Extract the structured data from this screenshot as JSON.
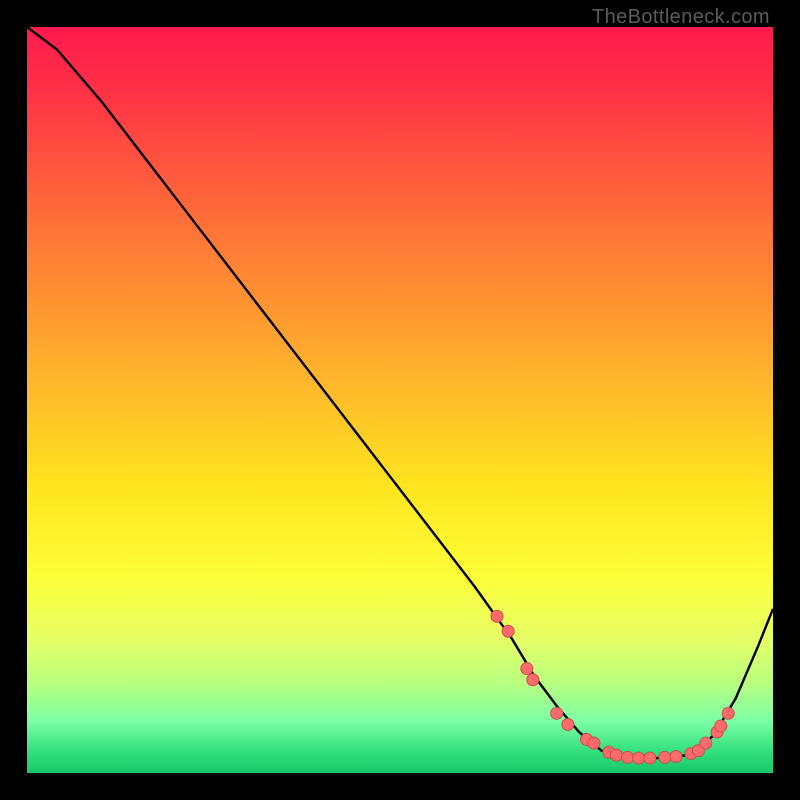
{
  "watermark": "TheBottleneck.com",
  "colors": {
    "bg": "#000000",
    "curve": "#000000",
    "marker_fill": "#ff6b6b",
    "marker_stroke": "#c94b4b"
  },
  "chart_data": {
    "type": "line",
    "title": "",
    "xlabel": "",
    "ylabel": "",
    "xlim": [
      0,
      100
    ],
    "ylim": [
      0,
      100
    ],
    "series": [
      {
        "name": "curve",
        "x": [
          0,
          4,
          10,
          20,
          30,
          40,
          50,
          60,
          65,
          68,
          71,
          74,
          77,
          80,
          83,
          86,
          89,
          92,
          95,
          98,
          100
        ],
        "y": [
          100,
          97,
          90,
          77,
          64,
          51,
          38,
          25,
          18,
          13,
          9,
          5.5,
          3,
          2,
          2,
          2,
          2.5,
          5,
          10,
          17,
          22
        ]
      }
    ],
    "markers": [
      {
        "x": 63,
        "y": 21
      },
      {
        "x": 64.5,
        "y": 19
      },
      {
        "x": 67,
        "y": 14
      },
      {
        "x": 67.8,
        "y": 12.5
      },
      {
        "x": 71,
        "y": 8
      },
      {
        "x": 72.5,
        "y": 6.5
      },
      {
        "x": 75,
        "y": 4.5
      },
      {
        "x": 76,
        "y": 4
      },
      {
        "x": 78,
        "y": 2.8
      },
      {
        "x": 79,
        "y": 2.4
      },
      {
        "x": 80.5,
        "y": 2.1
      },
      {
        "x": 82,
        "y": 2
      },
      {
        "x": 83.5,
        "y": 2
      },
      {
        "x": 85.5,
        "y": 2.1
      },
      {
        "x": 87,
        "y": 2.2
      },
      {
        "x": 89,
        "y": 2.6
      },
      {
        "x": 90,
        "y": 3
      },
      {
        "x": 91,
        "y": 4
      },
      {
        "x": 92.5,
        "y": 5.5
      },
      {
        "x": 93,
        "y": 6.3
      },
      {
        "x": 94,
        "y": 8
      }
    ]
  }
}
